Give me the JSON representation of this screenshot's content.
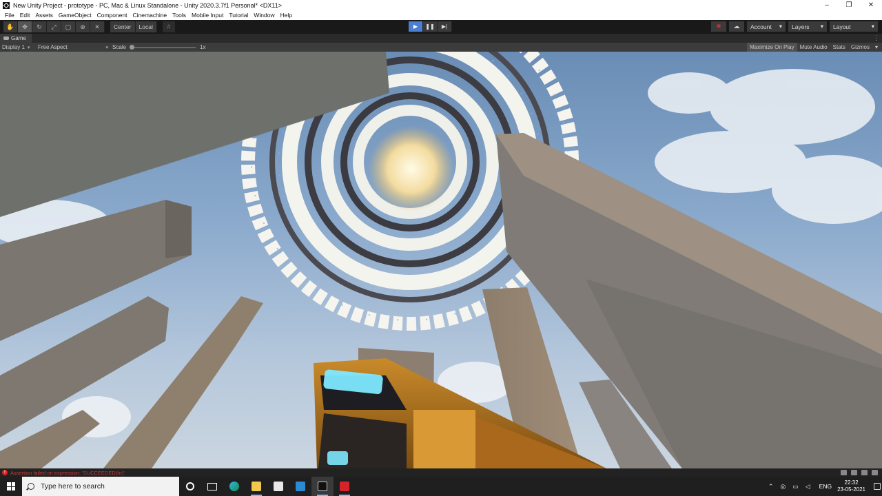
{
  "window": {
    "title": "New Unity Project - prototype - PC, Mac & Linux Standalone - Unity 2020.3.7f1 Personal* <DX11>",
    "controls": [
      "–",
      "❐",
      "✕"
    ]
  },
  "menu": [
    "File",
    "Edit",
    "Assets",
    "GameObject",
    "Component",
    "Cinemachine",
    "Tools",
    "Mobile Input",
    "Tutorial",
    "Window",
    "Help"
  ],
  "toolbar": {
    "tools": [
      "hand-tool-icon",
      "move-tool-icon",
      "rotate-tool-icon",
      "scale-tool-icon",
      "rect-tool-icon",
      "transform-tool-icon",
      "custom-tool-icon"
    ],
    "pivot_mode": "Center",
    "pivot_space": "Local",
    "account": "Account",
    "layers": "Layers",
    "layout": "Layout"
  },
  "game_view": {
    "tab": "Game",
    "display": "Display 1",
    "aspect": "Free Aspect",
    "scale_label": "Scale",
    "scale_value": "1x",
    "maximize": "Maximize On Play",
    "mute": "Mute Audio",
    "stats": "Stats",
    "gizmos": "Gizmos"
  },
  "status": {
    "message": "Assertion failed on expression: 'SUCCEEDED(hr)'"
  },
  "taskbar": {
    "search_placeholder": "Type here to search",
    "language": "ENG",
    "time": "22:32",
    "date": "23-05-2021"
  },
  "colors": {
    "play_active": "#4c7fd1",
    "error_text": "#c23a3a",
    "toolbar_bg": "#191919",
    "panel_bg": "#3c3c3c"
  }
}
